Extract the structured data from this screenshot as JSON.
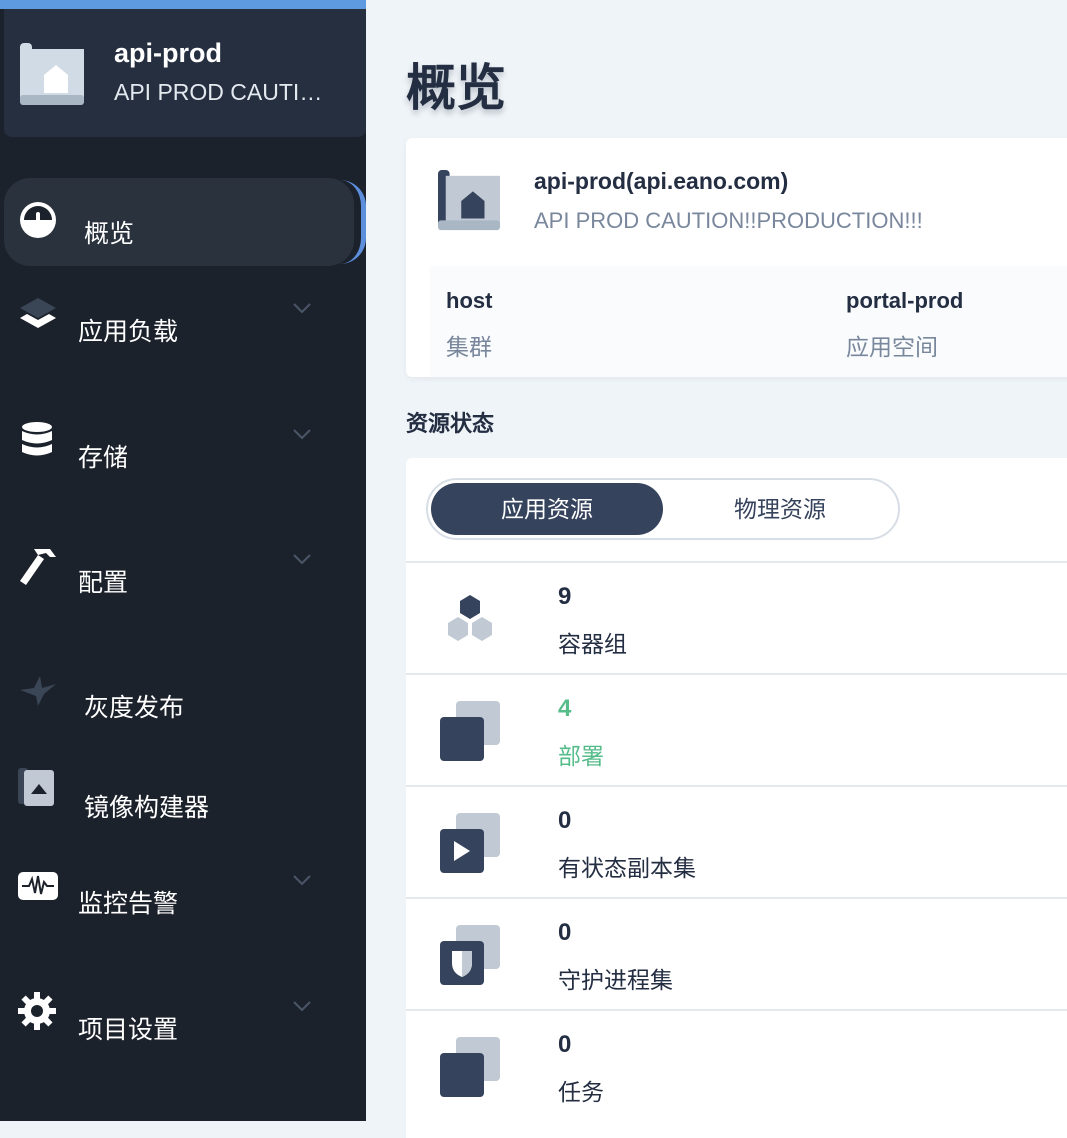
{
  "project": {
    "name": "api-prod",
    "description": "API PROD CAUTION!!PRODUCTION!!!"
  },
  "sidebar": {
    "items": [
      {
        "label": "概览",
        "icon": "dashboard-icon",
        "active": true,
        "expandable": false
      },
      {
        "label": "应用负载",
        "icon": "layers-icon",
        "active": false,
        "expandable": true
      },
      {
        "label": "存储",
        "icon": "database-icon",
        "active": false,
        "expandable": true
      },
      {
        "label": "配置",
        "icon": "hammer-icon",
        "active": false,
        "expandable": true
      },
      {
        "label": "灰度发布",
        "icon": "bird-icon",
        "active": false,
        "expandable": false
      },
      {
        "label": "镜像构建器",
        "icon": "image-builder-icon",
        "active": false,
        "expandable": false
      },
      {
        "label": "监控告警",
        "icon": "monitor-pulse-icon",
        "active": false,
        "expandable": true
      },
      {
        "label": "项目设置",
        "icon": "gear-icon",
        "active": false,
        "expandable": true
      }
    ]
  },
  "main": {
    "title": "概览",
    "info": {
      "title": "api-prod(api.eano.com)",
      "description": "API PROD CAUTION!!PRODUCTION!!!",
      "fields": [
        {
          "value": "host",
          "label": "集群"
        },
        {
          "value": "portal-prod",
          "label": "应用空间"
        }
      ]
    },
    "resources": {
      "section_title": "资源状态",
      "tabs": [
        {
          "label": "应用资源",
          "active": true
        },
        {
          "label": "物理资源",
          "active": false
        }
      ],
      "items": [
        {
          "count": "9",
          "label": "容器组",
          "icon": "pods-icon",
          "highlight": false
        },
        {
          "count": "4",
          "label": "部署",
          "icon": "deployment-icon",
          "highlight": true
        },
        {
          "count": "0",
          "label": "有状态副本集",
          "icon": "statefulset-icon",
          "highlight": false
        },
        {
          "count": "0",
          "label": "守护进程集",
          "icon": "daemonset-icon",
          "highlight": false
        },
        {
          "count": "0",
          "label": "任务",
          "icon": "job-icon",
          "highlight": false
        }
      ]
    }
  },
  "colors": {
    "sidebar_bg": "#1c222b",
    "project_card_bg": "#252f40",
    "accent_blue": "#5c8edc",
    "active_tab": "#36435c",
    "highlight_green": "#55bc8a",
    "text_dark": "#242e42",
    "text_muted": "#79879c"
  }
}
